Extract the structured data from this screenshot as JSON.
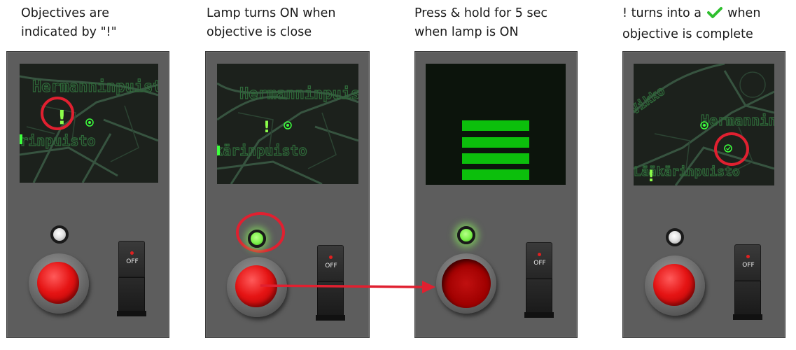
{
  "captions": [
    {
      "line1": "Objectives are",
      "line2": "indicated by \"!\""
    },
    {
      "line1": "Lamp turns ON when",
      "line2": "objective is close"
    },
    {
      "line1": "Press & hold for 5 sec",
      "line2": "when lamp is ON"
    },
    {
      "line1a": "! turns into a",
      "line1b": "when",
      "line2": "objective is complete"
    }
  ],
  "map_labels": {
    "street": "Hermanninpuisto",
    "park": "Lääkärinpuisto",
    "corner": "Vikko"
  },
  "marker_text": "!",
  "switch_label": "OFF",
  "colors": {
    "highlight_circle": "#e02030",
    "arrow": "#e02030",
    "marker_green": "#3dff3d",
    "progress_green": "#0cbf0c"
  },
  "progress_bars_shown": 4
}
